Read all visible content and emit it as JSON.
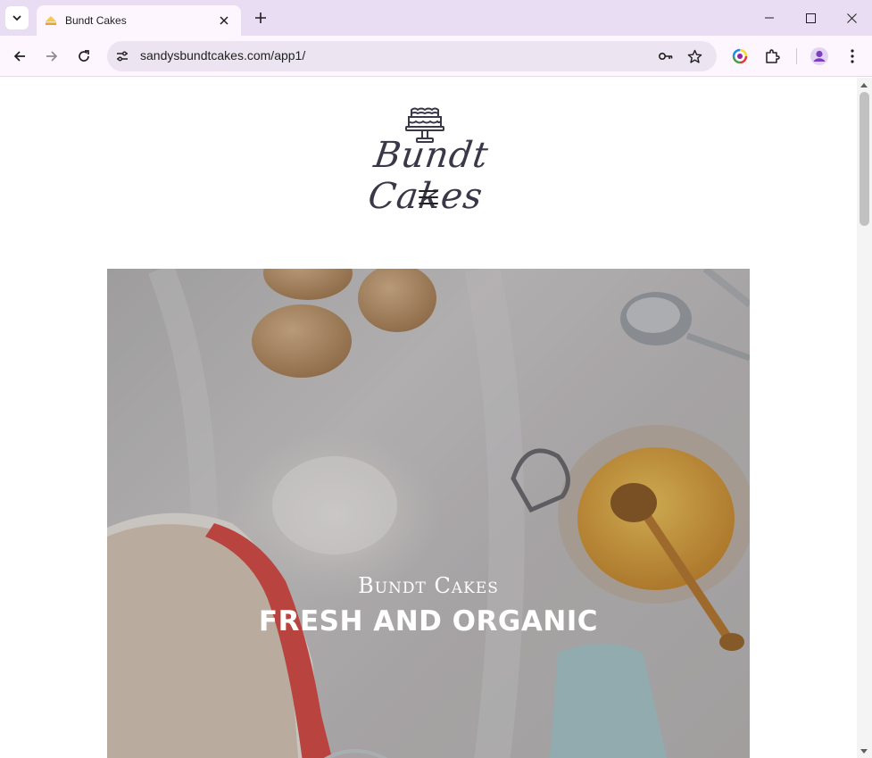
{
  "browser": {
    "tab_title": "Bundt Cakes",
    "url": "sandysbundtcakes.com/app1/"
  },
  "site": {
    "logo_text": "Bundt Cakes",
    "hero_subtitle": "Bundt Cakes",
    "hero_title": "FRESH AND ORGANIC"
  },
  "icons": {
    "tab_search": "chevron-down-icon",
    "favicon": "cake-icon",
    "tab_close": "close-icon",
    "new_tab": "plus-icon",
    "back": "arrow-left-icon",
    "forward": "arrow-right-icon",
    "reload": "reload-icon",
    "site_info": "tune-icon",
    "password": "key-icon",
    "bookmark": "star-icon",
    "extension_color": "color-wheel-icon",
    "extensions": "puzzle-icon",
    "profile": "avatar-icon",
    "menu": "kebab-menu-icon",
    "hamburger": "hamburger-menu-icon"
  },
  "colors": {
    "tabstrip": "#e9ddf3",
    "toolbar": "#fdf6ff",
    "omnibox": "#ece4f1",
    "logo": "#3a3848",
    "profile": "#7b3fbf"
  }
}
